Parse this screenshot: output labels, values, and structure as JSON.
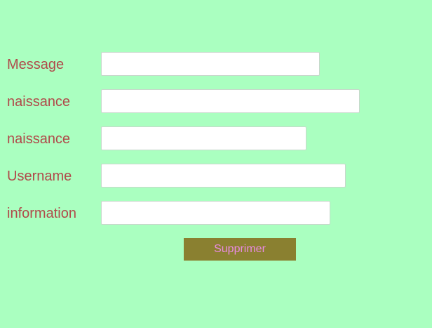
{
  "form": {
    "fields": [
      {
        "label": "Message",
        "value": "",
        "placeholder": ""
      },
      {
        "label": "naissance",
        "value": "",
        "placeholder": ""
      },
      {
        "label": "naissance",
        "value": "",
        "placeholder": ""
      },
      {
        "label": "Username",
        "value": "",
        "placeholder": ""
      },
      {
        "label": "information",
        "value": "",
        "placeholder": ""
      }
    ],
    "submit_label": "Supprimer"
  },
  "colors": {
    "background": "#aaffc0",
    "label_text": "#b04a4a",
    "button_background": "#8a8030",
    "button_text": "#e98be0"
  }
}
